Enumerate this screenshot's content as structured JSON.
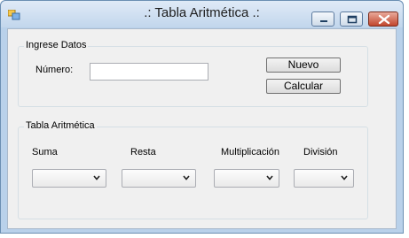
{
  "window": {
    "title": ".: Tabla Aritmética .:"
  },
  "ingrese": {
    "legend": "Ingrese Datos",
    "numero_label": "Número:",
    "numero_value": "",
    "nuevo_label": "Nuevo",
    "calcular_label": "Calcular"
  },
  "tabla": {
    "legend": "Tabla Aritmética",
    "suma_label": "Suma",
    "resta_label": "Resta",
    "multiplicacion_label": "Multiplicación",
    "division_label": "División"
  },
  "icons": [
    "app-icon",
    "minimize-icon",
    "maximize-icon",
    "close-icon",
    "chevron-down-icon"
  ]
}
